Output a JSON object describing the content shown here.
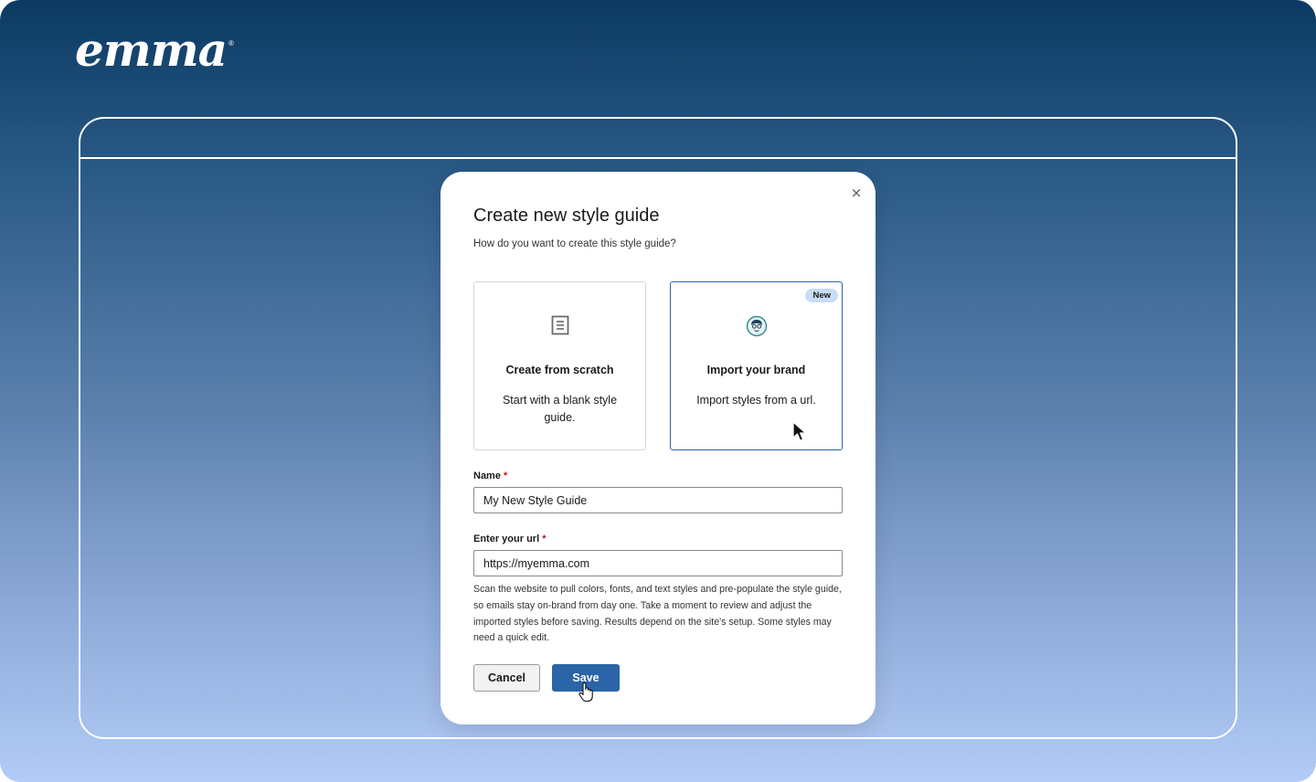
{
  "brand": {
    "logo_text": "emma",
    "registered_mark": "®"
  },
  "modal": {
    "close_label": "×",
    "title": "Create new style guide",
    "subtitle": "How do you want to create this style guide?",
    "options": [
      {
        "icon": "document-icon",
        "title": "Create from scratch",
        "description": "Start with a blank style guide.",
        "selected": false
      },
      {
        "icon": "brand-import-icon",
        "title": "Import your brand",
        "description": "Import styles from a url.",
        "badge": "New",
        "selected": true
      }
    ],
    "name_field": {
      "label": "Name",
      "required_mark": "*",
      "value": "My New Style Guide"
    },
    "url_field": {
      "label": "Enter your url",
      "required_mark": "*",
      "value": "https://myemma.com"
    },
    "help_text": "Scan the website to pull colors, fonts, and text styles and pre-populate the style guide, so emails stay on-brand from day one. Take a moment to review and adjust the imported styles before saving. Results depend on the site's setup. Some styles may need a quick edit.",
    "buttons": {
      "cancel": "Cancel",
      "save": "Save"
    }
  },
  "colors": {
    "accent": "#2c64a8",
    "badge_bg": "#c9dbf7",
    "required": "#c0141c",
    "bg_top": "#0b3a63",
    "bg_bottom": "#b2ccf7"
  }
}
